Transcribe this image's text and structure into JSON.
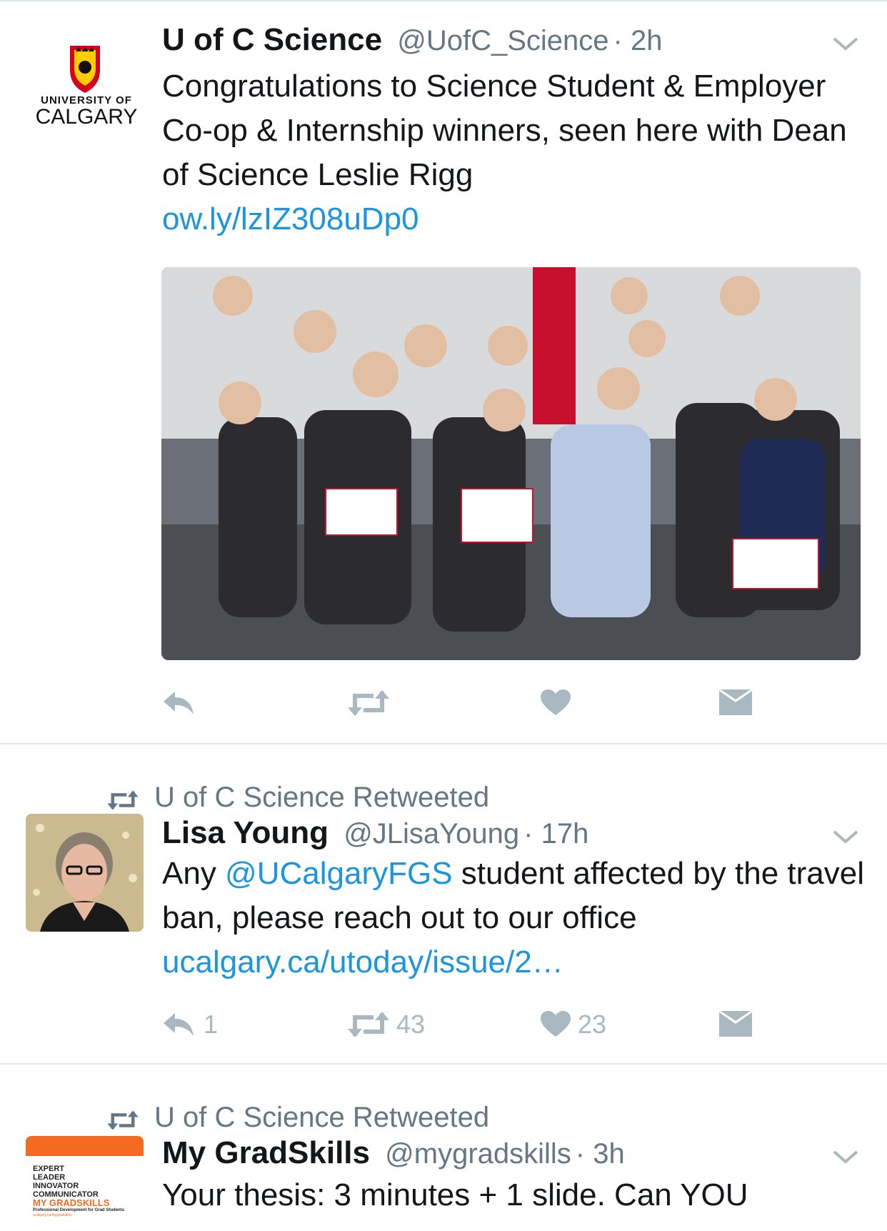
{
  "tweets": [
    {
      "name": "U of C Science",
      "handle": "@UofC_Science",
      "time": "· 2h",
      "text": "Congratulations to Science Student & Employer Co-op & Internship winners, seen here with Dean of Science Leslie Rigg",
      "link": "ow.ly/lzIZ308uDp0",
      "avatar_lines": [
        "UNIVERSITY OF",
        "CALGARY"
      ]
    },
    {
      "retweeted_by": "U of C Science Retweeted",
      "name": "Lisa Young",
      "handle": "@JLisaYoung",
      "time": "· 17h",
      "text_before": "Any ",
      "mention": "@UCalgaryFGS",
      "text_after": " student affected by the travel ban, please reach out to our office ",
      "link": "ucalgary.ca/utoday/issue/2…",
      "replies": "1",
      "retweets": "43",
      "likes": "23"
    },
    {
      "retweeted_by": "U of C Science Retweeted",
      "name": "My GradSkills",
      "handle": "@mygradskills",
      "time": "· 3h",
      "text": "Your thesis: 3 minutes + 1 slide. Can YOU",
      "avatar_lines": [
        "EXPERT",
        "LEADER",
        "INNOVATOR",
        "COMMUNICATOR",
        "MY GRADSKILLS",
        "Professional Development for Grad Students",
        "ucalgary.ca/mygradskills"
      ]
    }
  ],
  "colors": {
    "link": "#1b95e0",
    "muted": "#657786",
    "icon": "#aab8c2",
    "brand_orange": "#f26b21",
    "calgary_red": "#d6001c"
  }
}
